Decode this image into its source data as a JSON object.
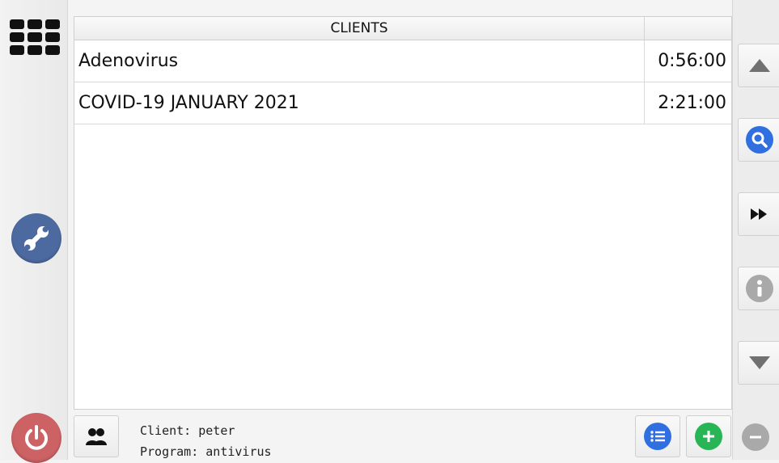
{
  "table": {
    "header": "CLIENTS",
    "rows": [
      {
        "name": "Adenovirus",
        "time": "0:56:00"
      },
      {
        "name": "COVID-19 JANUARY 2021",
        "time": "2:21:00"
      }
    ]
  },
  "status": {
    "client_line": "Client: peter",
    "program_line": "Program: antivirus"
  },
  "icons": {
    "apps": "apps-grid-icon",
    "tools": "wrench-icon",
    "power": "power-icon",
    "scroll_up": "triangle-up-icon",
    "search": "magnifier-icon",
    "fast_forward": "fast-forward-icon",
    "info": "info-icon",
    "scroll_down": "triangle-down-icon",
    "client": "users-icon",
    "list": "list-icon",
    "add": "plus-icon",
    "remove": "minus-icon"
  },
  "colors": {
    "tools": "#4d6aa0",
    "power": "#cd6265",
    "search": "#2f6fe0",
    "list": "#2f6fe0",
    "add": "#28b556",
    "disabled": "#a9a9a9"
  }
}
